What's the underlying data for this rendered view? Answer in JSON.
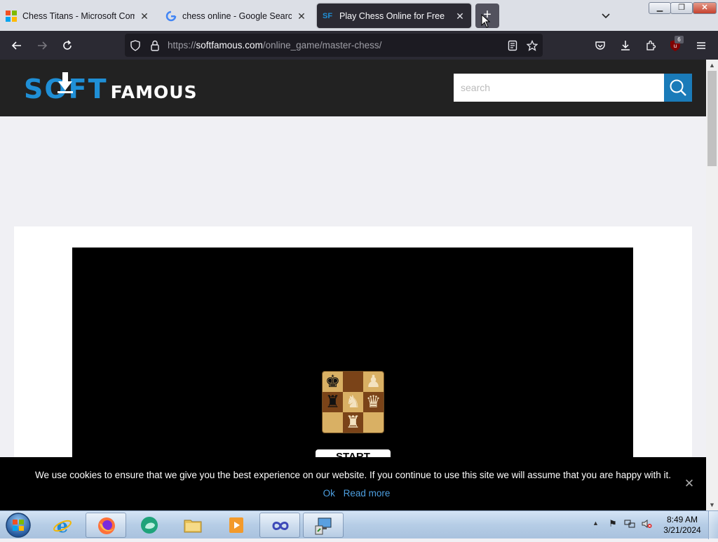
{
  "browser": {
    "tabs": [
      {
        "title": "Chess Titans - Microsoft Comm",
        "icon": "microsoft-store-icon",
        "active": false
      },
      {
        "title": "chess online - Google Search",
        "icon": "google-icon",
        "active": false
      },
      {
        "title": "Play Chess Online for Free",
        "icon": "softfamous-icon",
        "active": true
      }
    ],
    "tab_close_glyph": "✕",
    "new_tab_glyph": "+",
    "url_prefix": "https://",
    "url_host": "softfamous.com",
    "url_path": "/online_game/master-chess/",
    "extension_badge": "6"
  },
  "site": {
    "logo_soft": "SOFT",
    "logo_famous": "FAMOUS",
    "search_placeholder": "search",
    "colors": {
      "brand_blue": "#1f8fd6",
      "header_bg": "#222222",
      "search_button": "#1a7bb9"
    }
  },
  "game": {
    "start_label": "START"
  },
  "cookie": {
    "message": "We use cookies to ensure that we give you the best experience on our website. If you continue to use this site we will assume that you are happy with it.",
    "ok_label": "Ok",
    "read_more_label": "Read more",
    "close_glyph": "✕"
  },
  "taskbar": {
    "time": "8:49 AM",
    "date": "3/21/2024"
  }
}
